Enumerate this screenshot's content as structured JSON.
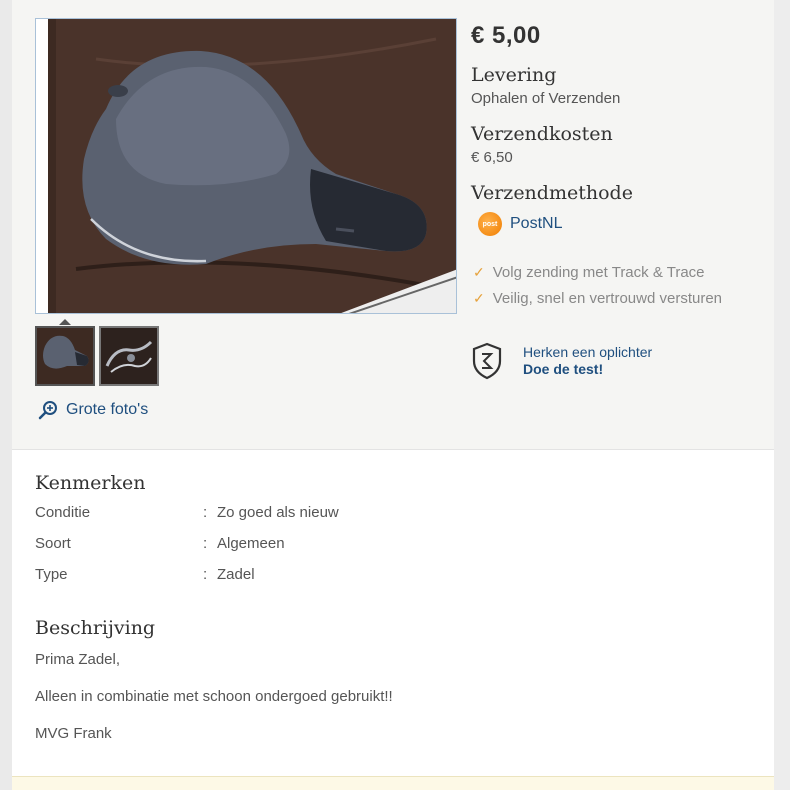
{
  "listing": {
    "price": "€ 5,00",
    "delivery": {
      "title": "Levering",
      "value": "Ophalen of Verzenden"
    },
    "shipping_cost": {
      "title": "Verzendkosten",
      "value": "€ 6,50"
    },
    "shipping_method": {
      "title": "Verzendmethode",
      "carrier": "PostNL",
      "carrier_logo_text": "post"
    },
    "benefits": [
      "Volg zending met Track & Trace",
      "Veilig, snel en vertrouwd versturen"
    ],
    "fraud": {
      "line1": "Herken een oplichter",
      "line2": "Doe de test!"
    }
  },
  "gallery": {
    "large_photos_label": "Grote foto's",
    "thumbnail_count": 2
  },
  "specs": {
    "title": "Kenmerken",
    "rows": [
      {
        "key": "Conditie",
        "value": "Zo goed als nieuw"
      },
      {
        "key": "Soort",
        "value": "Algemeen"
      },
      {
        "key": "Type",
        "value": "Zadel"
      }
    ]
  },
  "description": {
    "title": "Beschrijving",
    "paragraphs": [
      "Prima Zadel,",
      "Alleen in combinatie met schoon ondergoed gebruikt!!",
      "MVG Frank"
    ]
  },
  "colors": {
    "link": "#1f4f7f",
    "check": "#e6a23c",
    "postnl": "#f07d00"
  }
}
